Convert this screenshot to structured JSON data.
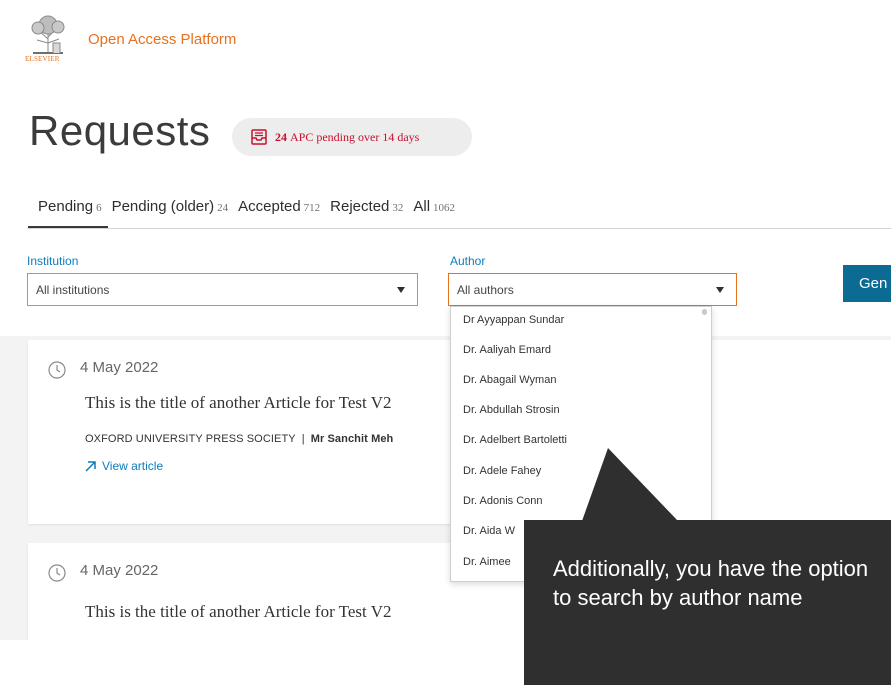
{
  "header": {
    "logo_text": "ELSEVIER",
    "app_title": "Open Access Platform"
  },
  "page": {
    "title": "Requests",
    "apc_badge": {
      "count": "24",
      "text": "APC pending over 14 days"
    }
  },
  "tabs": [
    {
      "label": "Pending",
      "count": "6",
      "active": true
    },
    {
      "label": "Pending (older)",
      "count": "24",
      "active": false
    },
    {
      "label": "Accepted",
      "count": "712",
      "active": false
    },
    {
      "label": "Rejected",
      "count": "32",
      "active": false
    },
    {
      "label": "All",
      "count": "1062",
      "active": false
    }
  ],
  "filters": {
    "institution": {
      "label": "Institution",
      "value": "All institutions"
    },
    "author": {
      "label": "Author",
      "value": "All authors"
    },
    "generate_button": "Gen"
  },
  "author_options": [
    "Dr Ayyappan Sundar",
    "Dr. Aaliyah Emard",
    "Dr. Abagail Wyman",
    "Dr. Abdullah Strosin",
    "Dr. Adelbert Bartoletti",
    "Dr. Adele Fahey",
    "Dr. Adonis Conn",
    "Dr. Aida W",
    "Dr. Aimee"
  ],
  "cards": [
    {
      "date": "4 May 2022",
      "title": "This is the title of another Article for Test V2",
      "publisher": "OXFORD UNIVERSITY PRESS SOCIETY",
      "separator": "|",
      "author": "Mr Sanchit Meh",
      "link": "View article"
    },
    {
      "date": "4 May 2022",
      "title": "This is the title of another Article for Test V2"
    }
  ],
  "tooltip": {
    "text": "Additionally, you have the option to search by author name"
  },
  "colors": {
    "brand_orange": "#e9711c",
    "link_blue": "#0c7dbb",
    "button_blue": "#0c6b93",
    "alert_red": "#c8102e",
    "tooltip_bg": "#2f2f2f"
  }
}
